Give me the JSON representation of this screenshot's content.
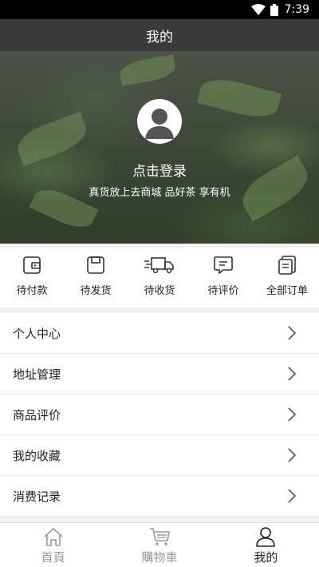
{
  "status_bar": {
    "time": "7:39"
  },
  "header": {
    "title": "我的"
  },
  "profile": {
    "login_text": "点击登录",
    "slogan": "真货放上去商城 品好茶 享有机"
  },
  "orders": [
    {
      "label": "待付款",
      "icon": "wallet-icon"
    },
    {
      "label": "待发货",
      "icon": "save-box-icon"
    },
    {
      "label": "待收货",
      "icon": "truck-icon"
    },
    {
      "label": "待评价",
      "icon": "comment-icon"
    },
    {
      "label": "全部订单",
      "icon": "orders-list-icon"
    }
  ],
  "menu": [
    {
      "label": "个人中心"
    },
    {
      "label": "地址管理"
    },
    {
      "label": "商品评价"
    },
    {
      "label": "我的收藏"
    },
    {
      "label": "消费记录"
    }
  ],
  "tabbar": {
    "items": [
      {
        "label": "首頁",
        "icon": "home-icon"
      },
      {
        "label": "購物車",
        "icon": "cart-icon"
      },
      {
        "label": "我的",
        "icon": "user-icon"
      }
    ],
    "active_index": 2
  },
  "colors": {
    "header_bg": "#3a3a3a",
    "active_tab": "#222222",
    "inactive_tab": "#999999"
  }
}
